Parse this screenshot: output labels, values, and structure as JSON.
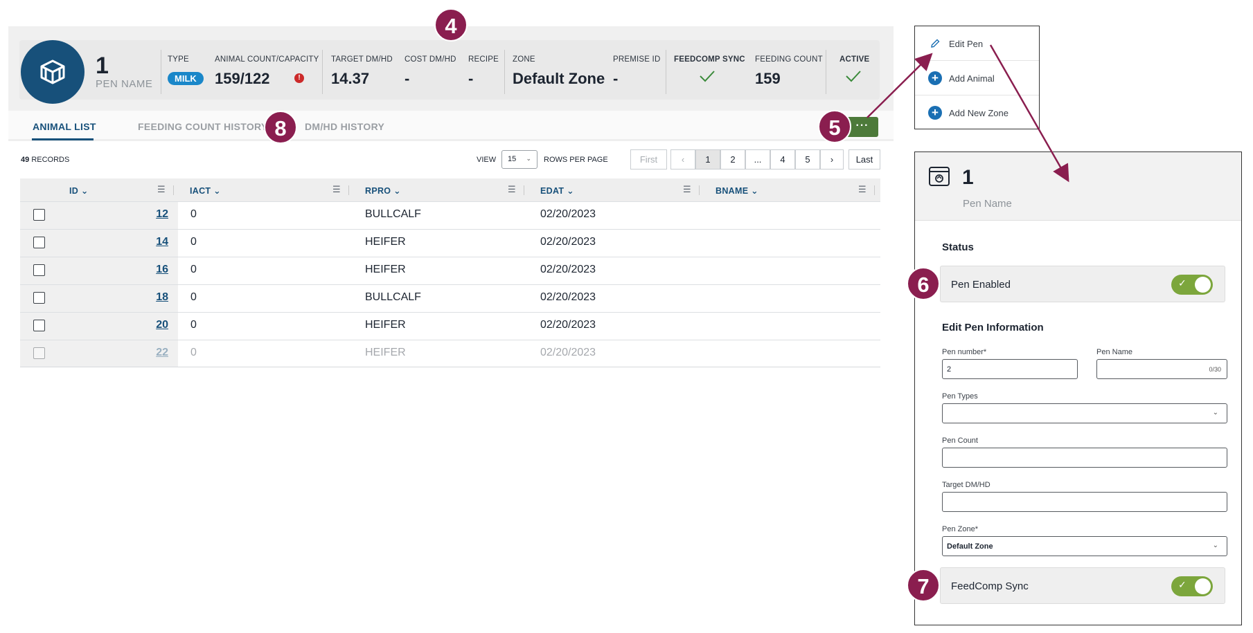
{
  "header": {
    "pen_number": "1",
    "pen_name_label": "PEN NAME",
    "type_label": "TYPE",
    "type_value": "MILK",
    "count_label": "ANIMAL COUNT/CAPACITY",
    "count_value": "159/122",
    "warning_icon": "!",
    "target_label": "TARGET DM/HD",
    "target_value": "14.37",
    "cost_label": "COST DM/HD",
    "cost_value": "-",
    "recipe_label": "RECIPE",
    "recipe_value": "-",
    "zone_label": "ZONE",
    "zone_value": "Default Zone",
    "premise_label": "PREMISE ID",
    "premise_value": "-",
    "feedcomp_label": "FEEDCOMP  SYNC",
    "feeding_label": "FEEDING COUNT",
    "feeding_value": "159",
    "active_label": "ACTIVE"
  },
  "annotations": {
    "a4": "4",
    "a5": "5",
    "a6": "6",
    "a7": "7",
    "a8": "8"
  },
  "tabs": [
    {
      "label": "ANIMAL LIST"
    },
    {
      "label": "FEEDING COUNT HISTORY"
    },
    {
      "label": "DM/HD HISTORY"
    }
  ],
  "more_button": "···",
  "records": {
    "count": "49",
    "label": "RECORDS"
  },
  "view": {
    "label": "VIEW",
    "value": "15",
    "suffix": "ROWS PER PAGE"
  },
  "pagination": [
    "First",
    "‹",
    "1",
    "2",
    "...",
    "4",
    "5",
    "›",
    "Last"
  ],
  "table": {
    "columns": [
      "ID",
      "IACT",
      "RPRO",
      "EDAT",
      "BNAME"
    ],
    "rows": [
      {
        "id": "12",
        "iact": "0",
        "rpro": "BULLCALF",
        "edat": "02/20/2023"
      },
      {
        "id": "14",
        "iact": "0",
        "rpro": "HEIFER",
        "edat": "02/20/2023"
      },
      {
        "id": "16",
        "iact": "0",
        "rpro": "HEIFER",
        "edat": "02/20/2023"
      },
      {
        "id": "18",
        "iact": "0",
        "rpro": "BULLCALF",
        "edat": "02/20/2023"
      },
      {
        "id": "20",
        "iact": "0",
        "rpro": "HEIFER",
        "edat": "02/20/2023"
      },
      {
        "id": "22",
        "iact": "0",
        "rpro": "HEIFER",
        "edat": "02/20/2023"
      }
    ]
  },
  "menu": {
    "edit_pen": "Edit Pen",
    "add_animal": "Add Animal",
    "add_zone": "Add New Zone"
  },
  "panel": {
    "pen_number": "1",
    "pen_name": "Pen Name",
    "status_title": "Status",
    "pen_enabled": "Pen Enabled",
    "edit_title": "Edit Pen Information",
    "pen_number_label": "Pen number*",
    "pen_number_value": "2",
    "pen_name_label": "Pen Name",
    "pen_name_counter": "0/30",
    "pen_types_label": "Pen Types",
    "pen_count_label": "Pen Count",
    "target_label": "Target DM/HD",
    "zone_label": "Pen Zone*",
    "zone_value": "Default Zone",
    "feedcomp_sync": "FeedComp Sync",
    "check": "✓"
  },
  "colors": {
    "brand_blue": "#17507a",
    "annotation": "#8a1e4f",
    "toggle_green": "#7ca63c",
    "more_button": "#4d7a3a"
  }
}
